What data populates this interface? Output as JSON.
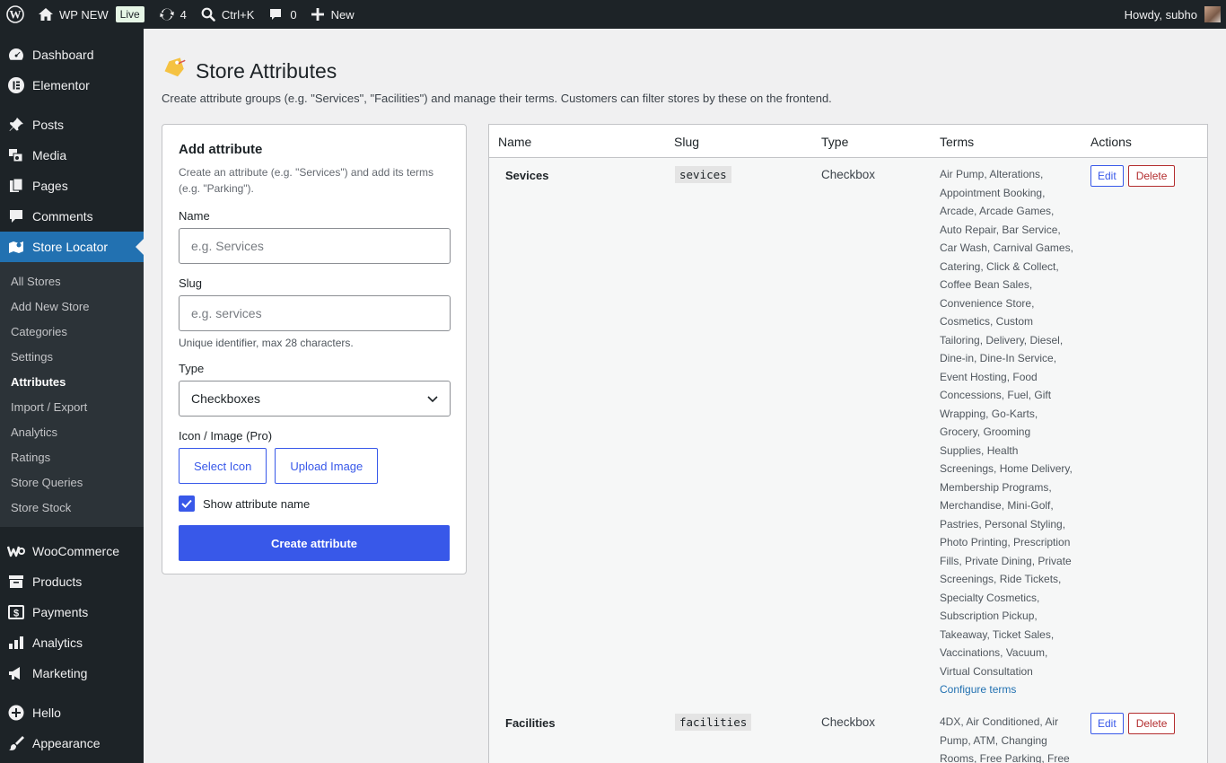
{
  "adminbar": {
    "site_name": "WP NEW",
    "live_badge": "Live",
    "updates_count": "4",
    "search_shortcut": "Ctrl+K",
    "comments_count": "0",
    "new_label": "New",
    "howdy": "Howdy, subho"
  },
  "sidebar": {
    "items_top": [
      {
        "label": "Dashboard",
        "icon": "dashboard-icon"
      },
      {
        "label": "Elementor",
        "icon": "elementor-icon"
      }
    ],
    "items_mid": [
      {
        "label": "Posts",
        "icon": "pin-icon"
      },
      {
        "label": "Media",
        "icon": "media-icon"
      },
      {
        "label": "Pages",
        "icon": "pages-icon"
      },
      {
        "label": "Comments",
        "icon": "comment-icon"
      },
      {
        "label": "Store Locator",
        "icon": "map-icon"
      }
    ],
    "submenu": [
      "All Stores",
      "Add New Store",
      "Categories",
      "Settings",
      "Attributes",
      "Import / Export",
      "Analytics",
      "Ratings",
      "Store Queries",
      "Store Stock"
    ],
    "submenu_current": "Attributes",
    "items_woo": [
      {
        "label": "WooCommerce",
        "icon": "woocommerce-icon"
      },
      {
        "label": "Products",
        "icon": "archive-icon"
      },
      {
        "label": "Payments",
        "icon": "dollar-icon"
      },
      {
        "label": "Analytics",
        "icon": "bar-chart-icon"
      },
      {
        "label": "Marketing",
        "icon": "megaphone-icon"
      }
    ],
    "items_bottom": [
      {
        "label": "Hello",
        "icon": "plus-circle-icon"
      },
      {
        "label": "Appearance",
        "icon": "brush-icon"
      }
    ]
  },
  "page": {
    "title": "Store Attributes",
    "description": "Create attribute groups (e.g. \"Services\", \"Facilities\") and manage their terms. Customers can filter stores by these on the frontend."
  },
  "form": {
    "heading": "Add attribute",
    "help": "Create an attribute (e.g. \"Services\") and add its terms (e.g. \"Parking\").",
    "name_label": "Name",
    "name_placeholder": "e.g. Services",
    "slug_label": "Slug",
    "slug_placeholder": "e.g. services",
    "slug_hint": "Unique identifier, max 28 characters.",
    "type_label": "Type",
    "type_value": "Checkboxes",
    "icon_label": "Icon / Image (Pro)",
    "select_icon": "Select Icon",
    "upload_image": "Upload Image",
    "show_name_label": "Show attribute name",
    "show_name_checked": true,
    "submit": "Create attribute"
  },
  "table": {
    "headers": {
      "name": "Name",
      "slug": "Slug",
      "type": "Type",
      "terms": "Terms",
      "actions": "Actions"
    },
    "rows": [
      {
        "name": "Sevices",
        "slug": "sevices",
        "type": "Checkbox",
        "terms": "Air Pump, Alterations, Appointment Booking, Arcade, Arcade Games, Auto Repair, Bar Service, Car Wash, Carnival Games, Catering, Click & Collect, Coffee Bean Sales, Convenience Store, Cosmetics, Custom Tailoring, Delivery, Diesel, Dine-in, Dine-In Service, Event Hosting, Food Concessions, Fuel, Gift Wrapping, Go-Karts, Grocery, Grooming Supplies, Health Screenings, Home Delivery, Membership Programs, Merchandise, Mini-Golf, Pastries, Personal Styling, Photo Printing, Prescription Fills, Private Dining, Private Screenings, Ride Tickets, Specialty Cosmetics, Subscription Pickup, Takeaway, Ticket Sales, Vaccinations, Vacuum, Virtual Consultation",
        "configure": "Configure terms",
        "edit": "Edit",
        "delete": "Delete"
      },
      {
        "name": "Facilities",
        "slug": "facilities",
        "type": "Checkbox",
        "terms": "4DX, Air Conditioned, Air Pump, ATM, Changing Rooms, Free Parking, Free",
        "edit": "Edit",
        "delete": "Delete"
      }
    ]
  },
  "colors": {
    "accent": "#3858e9",
    "admin_dark": "#1d2327",
    "active_menu": "#2271b1",
    "delete": "#b32d2e"
  }
}
